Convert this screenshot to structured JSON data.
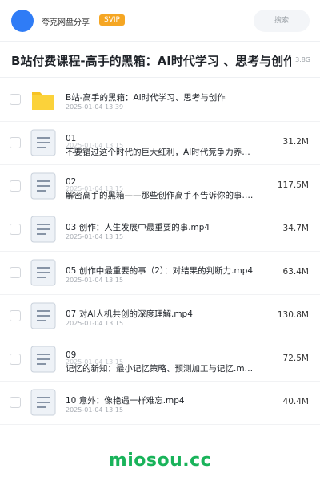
{
  "header": {
    "name": "夸克网盘分享",
    "badge": "SVIP",
    "search_label": "搜索"
  },
  "folder": {
    "title": "B站付费课程-高手的黑箱：AI时代学习 、思考与创作",
    "size": "3.8G"
  },
  "files": [
    {
      "type": "folder",
      "name": "B站-高手的黑箱：AI时代学习、思考与创作",
      "date": "2025-01-04 13:39",
      "size": ""
    },
    {
      "type": "doc",
      "name": "01",
      "name2": "不要错过这个时代的巨大红利，AI时代竞争力养…",
      "date": "2025-01-04 13:15",
      "size": "31.2M"
    },
    {
      "type": "doc",
      "name": "02",
      "name2": "解密高手的黑箱——那些创作高手不告诉你的事.…",
      "date": "2025-01-04 13:15",
      "size": "117.5M"
    },
    {
      "type": "doc",
      "name": "03 创作：人生发展中最重要的事.mp4",
      "date": "2025-01-04 13:15",
      "size": "34.7M"
    },
    {
      "type": "doc",
      "name": "05 创作中最重要的事（2）：对结果的判断力.mp4",
      "date": "2025-01-04 13:15",
      "size": "63.4M"
    },
    {
      "type": "doc",
      "name": "07 对AI人机共创的深度理解.mp4",
      "date": "2025-01-04 13:15",
      "size": "130.8M"
    },
    {
      "type": "doc",
      "name": "09",
      "name2": "记忆的新知：最小记忆策略、预测加工与记忆.m…",
      "date": "2025-01-04 13:15",
      "size": "72.5M"
    },
    {
      "type": "doc",
      "name": "10 意外：像艳遇一样难忘.mp4",
      "date": "2025-01-04 13:15",
      "size": "40.4M"
    }
  ],
  "watermark": "miosou.cc",
  "colors": {
    "accent": "#2f7cf6",
    "svip": "#f5a623",
    "folder": "#f7c325",
    "brand": "#19b35a"
  }
}
